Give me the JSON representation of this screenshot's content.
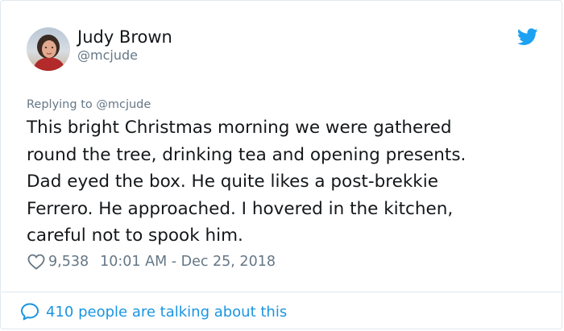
{
  "author": {
    "name": "Judy Brown",
    "handle": "@mcjude",
    "avatar_icon": "profile-photo"
  },
  "reply_context": {
    "text": "Replying to @mcjude"
  },
  "tweet": {
    "lines": [
      "This bright Christmas morning we were gathered",
      "round the tree, drinking tea and opening presents.",
      "Dad eyed the box. He quite likes a post-brekkie",
      "Ferrero. He approached. I hovered in the kitchen,",
      "careful not to spook him."
    ]
  },
  "meta": {
    "likes": "9,538",
    "timestamp": "10:01 AM - Dec 25, 2018",
    "like_icon": "heart-outline"
  },
  "footer": {
    "talking_label": "410 people are talking about this",
    "talking_icon": "speech-bubble"
  },
  "colors": {
    "twitter_blue": "#1da1f2",
    "link_blue": "#1b95e0",
    "secondary_text": "#657786",
    "primary_text": "#14171a",
    "border": "#e1e8ed"
  },
  "brand_icon": "twitter-bird"
}
